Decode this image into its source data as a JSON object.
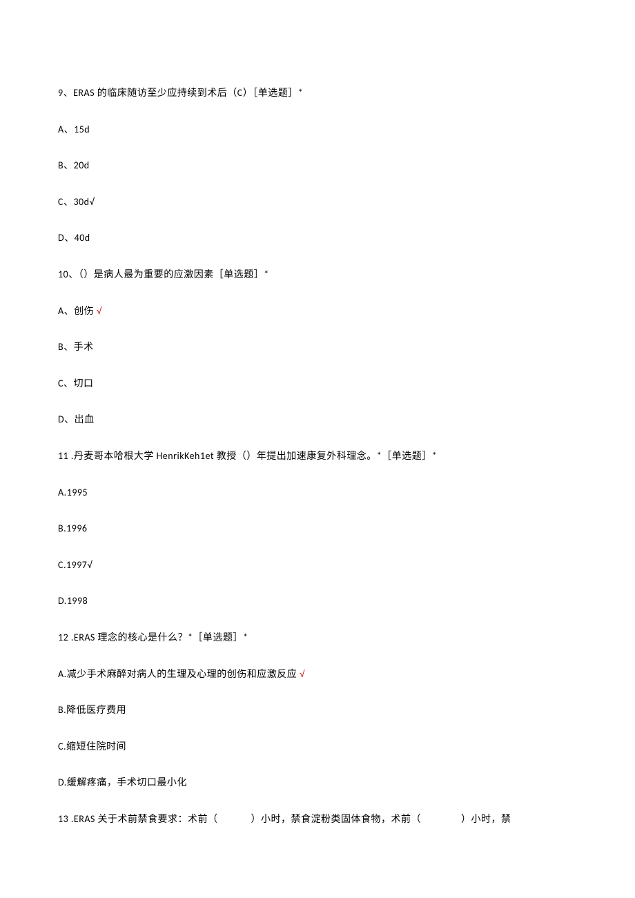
{
  "q9": {
    "stem": "9、ERAS 的临床随访至少应持续到术后（C）［单选题］*",
    "a": "A、15d",
    "b": "B、20d",
    "c": "C、30d√",
    "d": "D、40d"
  },
  "q10": {
    "stem": "10、（）是病人最为重要的应激因素［单选题］*",
    "a_pre": "A、创伤 ",
    "a_mark": "√",
    "b": "B、手术",
    "c": "C、切口",
    "d": "D、出血"
  },
  "q11": {
    "stem": "11    .丹麦哥本哈根大学 HenrikKeh1et 教授（）年提出加速康复外科理念。*［单选题］*",
    "a": "A.1995",
    "b": "B.1996",
    "c": "C.1997√",
    "d": "D.1998"
  },
  "q12": {
    "stem": "12    .ERAS 理念的核心是什么？*［单选题］*",
    "a_pre": "A.减少手术麻醉对病人的生理及心理的创伤和应激反应 ",
    "a_mark": "√",
    "b": "B.降低医疗费用",
    "c": "C.缩短住院时间",
    "d": "D.缓解疼痛，手术切口最小化"
  },
  "q13": {
    "pre": "13    .ERAS 关于术前禁食要求：术前（",
    "mid1": "）小时，禁食淀粉类固体食物，术前（",
    "mid2": "）小时，禁"
  }
}
